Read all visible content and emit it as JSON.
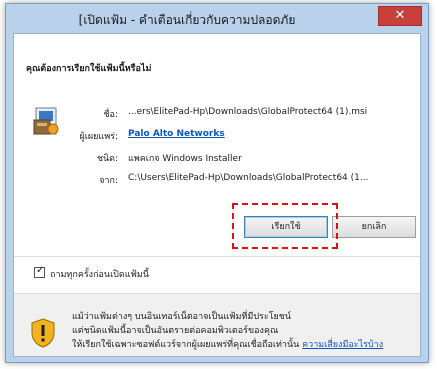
{
  "window": {
    "title": "[เปิดแฟ้ม - คำเตือนเกี่ยวกับความปลอดภัย",
    "close_glyph": "✕"
  },
  "dialog": {
    "question": "คุณต้องการเรียกใช้แฟ้มนี้หรือไม่",
    "fields": [
      {
        "label": "ชื่อ:",
        "value": "...ers\\ElitePad-Hp\\Downloads\\GlobalProtect64 (1).msi"
      },
      {
        "label": "ผู้เผยแพร่:",
        "value": "Palo Alto Networks"
      },
      {
        "label": "ชนิด:",
        "value": "แพคเกจ Windows Installer"
      },
      {
        "label": "จาก:",
        "value": "C:\\Users\\ElitePad-Hp\\Downloads\\GlobalProtect64 (1..."
      }
    ],
    "buttons": {
      "run": "เรียกใช้",
      "cancel": "ยกเลิก"
    },
    "checkbox": {
      "label": "ถามทุกครั้งก่อนเปิดแฟ้มนี้",
      "checked": true,
      "mark": "✓"
    },
    "warning": {
      "line1": "แม้ว่าแฟ้มต่างๆ บนอินเทอร์เน็ตอาจเป็นแฟ้มที่มีประโยชน์",
      "line2": "แต่ชนิดแฟ้มนี้อาจเป็นอันตรายต่อคอมพิวเตอร์ของคุณ",
      "line3": "ให้เรียกใช้เฉพาะซอฟต์แวร์จากผู้เผยแพร่ที่คุณเชื่อถือเท่านั้น",
      "link": "ความเสี่ยงมีอะไรบ้าง"
    }
  },
  "colors": {
    "frame": "#b9d1ea",
    "close": "#c7403a",
    "link": "#0b57c5",
    "highlight": "#e01010"
  },
  "icons": [
    "installer-file-icon",
    "shield-warning-icon",
    "close-icon",
    "checkmark-icon"
  ]
}
